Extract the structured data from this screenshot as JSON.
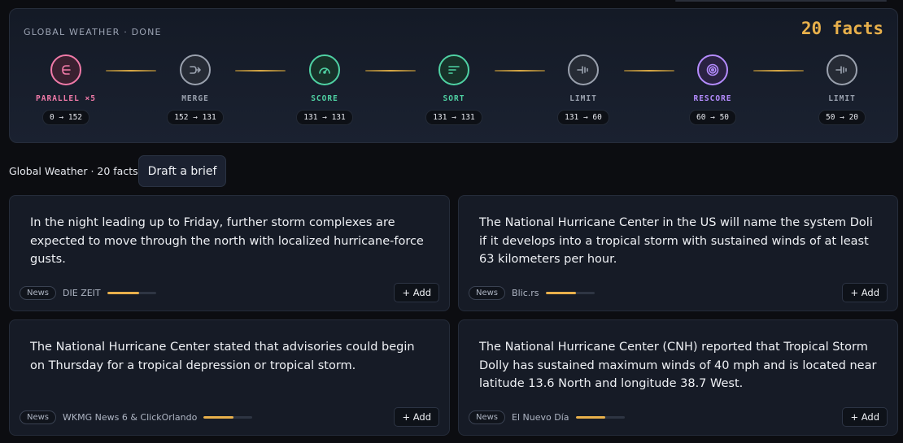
{
  "pipeline": {
    "title": "GLOBAL WEATHER · DONE",
    "facts_count": "20 facts",
    "stages": [
      {
        "label": "PARALLEL ×5",
        "count": "0 → 152",
        "icon": "parallel-icon",
        "color": "#f07aa8",
        "bg": "#3a2030"
      },
      {
        "label": "MERGE",
        "count": "152 → 131",
        "icon": "merge-icon",
        "color": "#9aa1ae",
        "bg": "#262b35"
      },
      {
        "label": "SCORE",
        "count": "131 → 131",
        "icon": "gauge-icon",
        "color": "#4fd1a3",
        "bg": "#173229"
      },
      {
        "label": "SORT",
        "count": "131 → 131",
        "icon": "sort-icon",
        "color": "#4fd1a3",
        "bg": "#173229"
      },
      {
        "label": "LIMIT",
        "count": "131 → 60",
        "icon": "limit-icon",
        "color": "#9aa1ae",
        "bg": "#262b35"
      },
      {
        "label": "RESCORE",
        "count": "60 → 50",
        "icon": "target-icon",
        "color": "#b58cff",
        "bg": "#2a2242"
      },
      {
        "label": "LIMIT",
        "count": "50 → 20",
        "icon": "limit-icon",
        "color": "#9aa1ae",
        "bg": "#262b35"
      }
    ]
  },
  "toolbar": {
    "collection_label": "Global Weather · 20 facts",
    "draft_label": "Draft a brief"
  },
  "cards": [
    {
      "text": "In the night leading up to Friday, further storm complexes are expected to move through the north with localized hurricane-force gusts.",
      "badge": "News",
      "source": "DIE ZEIT",
      "score": 0.65,
      "add_label": "+ Add"
    },
    {
      "text": "The National Hurricane Center in the US will name the system Doli if it develops into a tropical storm with sustained winds of at least 63 kilometers per hour.",
      "badge": "News",
      "source": "Blic.rs",
      "score": 0.62,
      "add_label": "+ Add"
    },
    {
      "text": "The National Hurricane Center stated that advisories could begin on Thursday for a tropical depression or tropical storm.",
      "badge": "News",
      "source": "WKMG News 6 & ClickOrlando",
      "score": 0.62,
      "add_label": "+ Add"
    },
    {
      "text": "The National Hurricane Center (CNH) reported that Tropical Storm Dolly has sustained maximum winds of 40 mph and is located near latitude 13.6 North and longitude 38.7 West.",
      "badge": "News",
      "source": "El Nuevo Día",
      "score": 0.6,
      "add_label": "+ Add"
    }
  ],
  "colors": {
    "accent": "#e8b04b"
  }
}
